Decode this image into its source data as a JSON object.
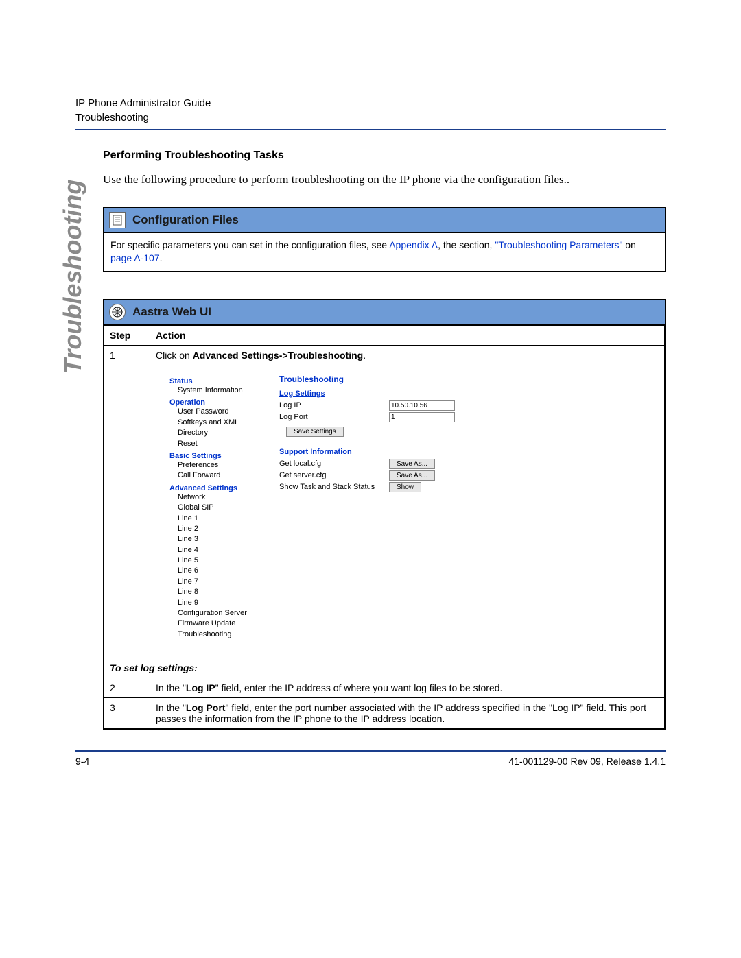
{
  "header": {
    "line1": "IP Phone Administrator Guide",
    "line2": "Troubleshooting"
  },
  "sideTab": "Troubleshooting",
  "sectionTitle": "Performing Troubleshooting Tasks",
  "intro": "Use the following procedure to perform troubleshooting on the IP phone via the configuration files..",
  "configPanel": {
    "title": "Configuration Files",
    "bodyPrefix": "For specific parameters you can set in the configuration files, see ",
    "link1": "Appendix A",
    "bodyMid": ", the section, ",
    "link2": "\"Troubleshooting Parameters\"",
    "bodySuffix1": " on ",
    "link3": "page A-107",
    "bodySuffix2": "."
  },
  "webPanel": {
    "title": "Aastra Web UI",
    "cols": {
      "step": "Step",
      "action": "Action"
    },
    "step1": {
      "num": "1",
      "prefix": "Click on ",
      "bold": "Advanced Settings->Troubleshooting",
      "suffix": "."
    },
    "screenshot": {
      "nav": {
        "status": "Status",
        "statusItems": [
          "System Information"
        ],
        "operation": "Operation",
        "operationItems": [
          "User Password",
          "Softkeys and XML",
          "Directory",
          "Reset"
        ],
        "basic": "Basic Settings",
        "basicItems": [
          "Preferences",
          "Call Forward"
        ],
        "advanced": "Advanced Settings",
        "advancedItems": [
          "Network",
          "Global SIP",
          "Line 1",
          "Line 2",
          "Line 3",
          "Line 4",
          "Line 5",
          "Line 6",
          "Line 7",
          "Line 8",
          "Line 9",
          "Configuration Server",
          "Firmware Update",
          "Troubleshooting"
        ]
      },
      "form": {
        "title": "Troubleshooting",
        "logSection": "Log Settings",
        "logIpLabel": "Log IP",
        "logIpValue": "10.50.10.56",
        "logPortLabel": "Log Port",
        "logPortValue": "1",
        "saveBtn": "Save Settings",
        "supportSection": "Support Information",
        "getLocal": "Get local.cfg",
        "getServer": "Get server.cfg",
        "showTask": "Show Task and Stack Status",
        "saveAs": "Save As...",
        "show": "Show"
      }
    },
    "subheader": "To set log settings:",
    "step2": {
      "num": "2",
      "prefix": "In the \"",
      "bold": "Log IP",
      "suffix": "\" field, enter the IP address of where you want log files to be stored."
    },
    "step3": {
      "num": "3",
      "prefix": "In the \"",
      "bold": "Log Port",
      "suffix": "\" field, enter the port number associated with the IP address specified in the \"Log IP\" field. This port passes the information from the IP phone to the IP address location."
    }
  },
  "footer": {
    "left": "9-4",
    "right": "41-001129-00 Rev 09, Release 1.4.1"
  }
}
